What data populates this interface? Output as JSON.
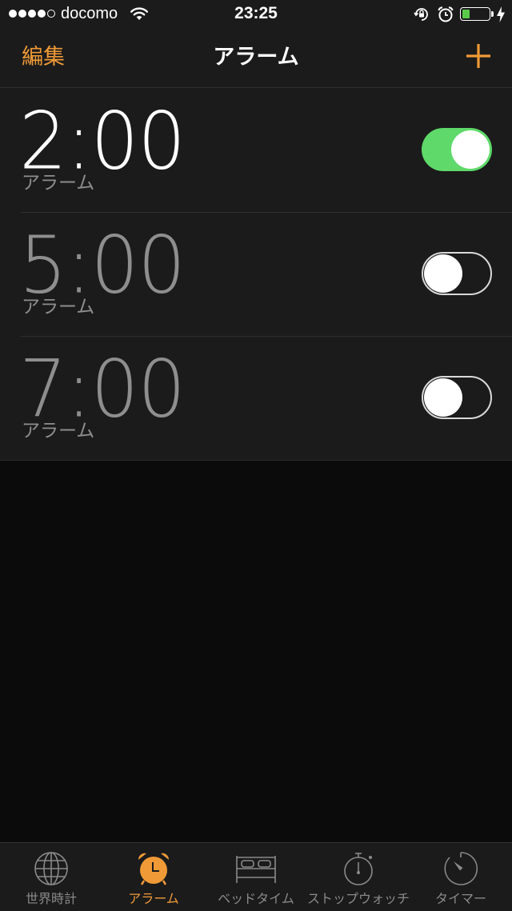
{
  "status_bar": {
    "carrier": "docomo",
    "time": "23:25",
    "signal_bars_filled": 4,
    "signal_bars_total": 5,
    "battery_level": 0.3
  },
  "nav": {
    "edit_label": "編集",
    "title": "アラーム",
    "add_icon": "plus-icon"
  },
  "alarms": [
    {
      "time": "2:00",
      "label": "アラーム",
      "enabled": true
    },
    {
      "time": "5:00",
      "label": "アラーム",
      "enabled": false
    },
    {
      "time": "7:00",
      "label": "アラーム",
      "enabled": false
    }
  ],
  "tabs": [
    {
      "label": "世界時計",
      "icon": "globe-icon",
      "active": false
    },
    {
      "label": "アラーム",
      "icon": "alarm-clock-icon",
      "active": true
    },
    {
      "label": "ベッドタイム",
      "icon": "bed-icon",
      "active": false
    },
    {
      "label": "ストップウォッチ",
      "icon": "stopwatch-icon",
      "active": false
    },
    {
      "label": "タイマー",
      "icon": "timer-icon",
      "active": false
    }
  ],
  "colors": {
    "accent": "#f09a37",
    "toggle_on": "#5fd96a",
    "background": "#0b0b0b",
    "surface": "#1b1b1b",
    "secondary_text": "#8e8e8e"
  }
}
